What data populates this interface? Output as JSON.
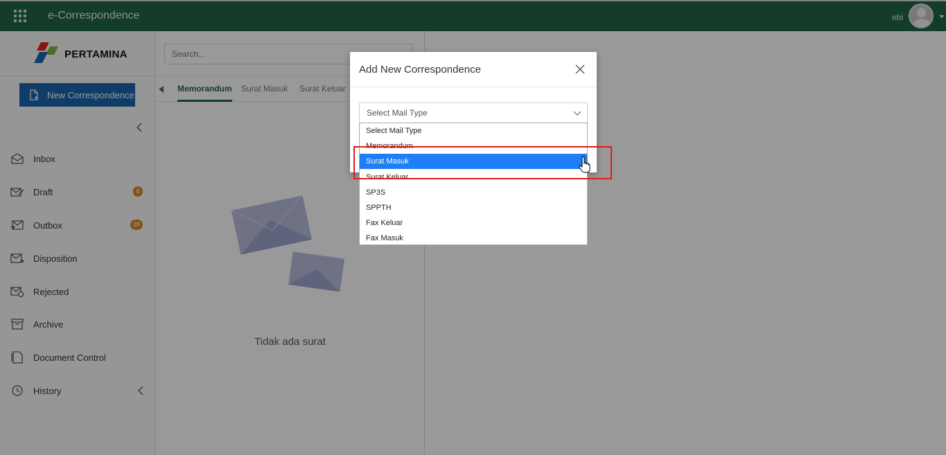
{
  "topbar": {
    "app_title": "e-Correspondence",
    "user_name": "ebi"
  },
  "sidebar": {
    "logo_text": "PERTAMINA",
    "new_button": "New Correspondence",
    "items": [
      {
        "label": "Inbox",
        "icon": "inbox-icon",
        "badge": ""
      },
      {
        "label": "Draft",
        "icon": "draft-icon",
        "badge": "8"
      },
      {
        "label": "Outbox",
        "icon": "outbox-icon",
        "badge": "38"
      },
      {
        "label": "Disposition",
        "icon": "disposition-icon",
        "badge": ""
      },
      {
        "label": "Rejected",
        "icon": "rejected-icon",
        "badge": ""
      },
      {
        "label": "Archive",
        "icon": "archive-icon",
        "badge": ""
      },
      {
        "label": "Document Control",
        "icon": "document-control-icon",
        "badge": ""
      },
      {
        "label": "History",
        "icon": "history-icon",
        "badge": ""
      }
    ]
  },
  "list": {
    "search_placeholder": "Search...",
    "tabs": [
      "Memorandum",
      "Surat Masuk",
      "Surat Keluar"
    ],
    "empty_text": "Tidak ada surat"
  },
  "modal": {
    "title": "Add New Correspondence",
    "select_value": "Select Mail Type",
    "options": [
      "Select Mail Type",
      "Memorandum",
      "Surat Masuk",
      "Surat Keluar",
      "SP3S",
      "SPPTH",
      "Fax Keluar",
      "Fax Masuk"
    ],
    "selected_option": "Surat Masuk"
  },
  "colors": {
    "topbar": "#216548",
    "primary_button": "#1b67ad",
    "badge": "#d98a24",
    "selected_option": "#1e7ef5",
    "highlight": "#e01b1b"
  }
}
